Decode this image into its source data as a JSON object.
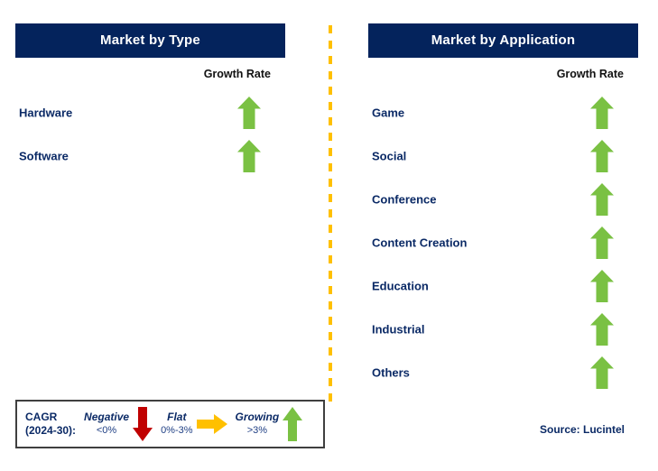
{
  "colors": {
    "navy": "#04235c",
    "label_navy": "#0b2a66",
    "green": "#7ac143",
    "red": "#c00000",
    "amber": "#ffc000",
    "divider": "#ffc000"
  },
  "panels": [
    {
      "title": "Market by Type",
      "growth_rate_label": "Growth Rate",
      "items": [
        {
          "label": "Hardware",
          "trend": "growing",
          "arrow_icon": "arrow-up-icon"
        },
        {
          "label": "Software",
          "trend": "growing",
          "arrow_icon": "arrow-up-icon"
        }
      ]
    },
    {
      "title": "Market by Application",
      "growth_rate_label": "Growth Rate",
      "items": [
        {
          "label": "Game",
          "trend": "growing",
          "arrow_icon": "arrow-up-icon"
        },
        {
          "label": "Social",
          "trend": "growing",
          "arrow_icon": "arrow-up-icon"
        },
        {
          "label": "Conference",
          "trend": "growing",
          "arrow_icon": "arrow-up-icon"
        },
        {
          "label": "Content Creation",
          "trend": "growing",
          "arrow_icon": "arrow-up-icon"
        },
        {
          "label": "Education",
          "trend": "growing",
          "arrow_icon": "arrow-up-icon"
        },
        {
          "label": "Industrial",
          "trend": "growing",
          "arrow_icon": "arrow-up-icon"
        },
        {
          "label": "Others",
          "trend": "growing",
          "arrow_icon": "arrow-up-icon"
        }
      ]
    }
  ],
  "legend": {
    "title_line1": "CAGR",
    "title_line2": "(2024-30):",
    "items": [
      {
        "state": "Negative",
        "range": "<0%",
        "arrow_icon": "arrow-down-icon",
        "color": "#c00000"
      },
      {
        "state": "Flat",
        "range": "0%-3%",
        "arrow_icon": "arrow-right-icon",
        "color": "#ffc000"
      },
      {
        "state": "Growing",
        "range": ">3%",
        "arrow_icon": "arrow-up-icon",
        "color": "#7ac143"
      }
    ]
  },
  "source": "Source: Lucintel"
}
